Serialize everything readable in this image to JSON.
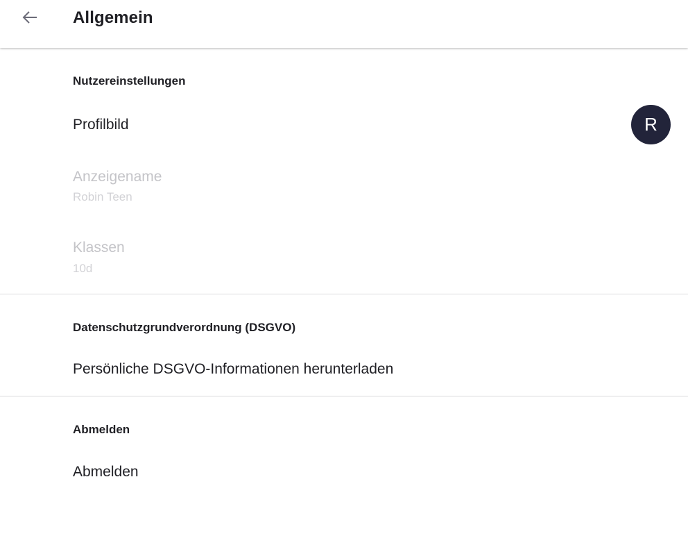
{
  "header": {
    "title": "Allgemein",
    "back_icon": "arrow-left-icon"
  },
  "sections": {
    "user": {
      "title": "Nutzereinstellungen",
      "profile_picture_label": "Profilbild",
      "avatar_initial": "R",
      "display_name_label": "Anzeigename",
      "display_name_value": "Robin Teen",
      "classes_label": "Klassen",
      "classes_value": "10d"
    },
    "gdpr": {
      "title": "Datenschutzgrundverordnung (DSGVO)",
      "download_label": "Persönliche DSGVO-Informationen herunterladen"
    },
    "logout": {
      "title": "Abmelden",
      "logout_label": "Abmelden"
    }
  },
  "colors": {
    "avatar_bg": "#22243a",
    "text_primary": "#1f1f24",
    "text_disabled": "#c4c4c8",
    "divider": "#dadadd"
  }
}
